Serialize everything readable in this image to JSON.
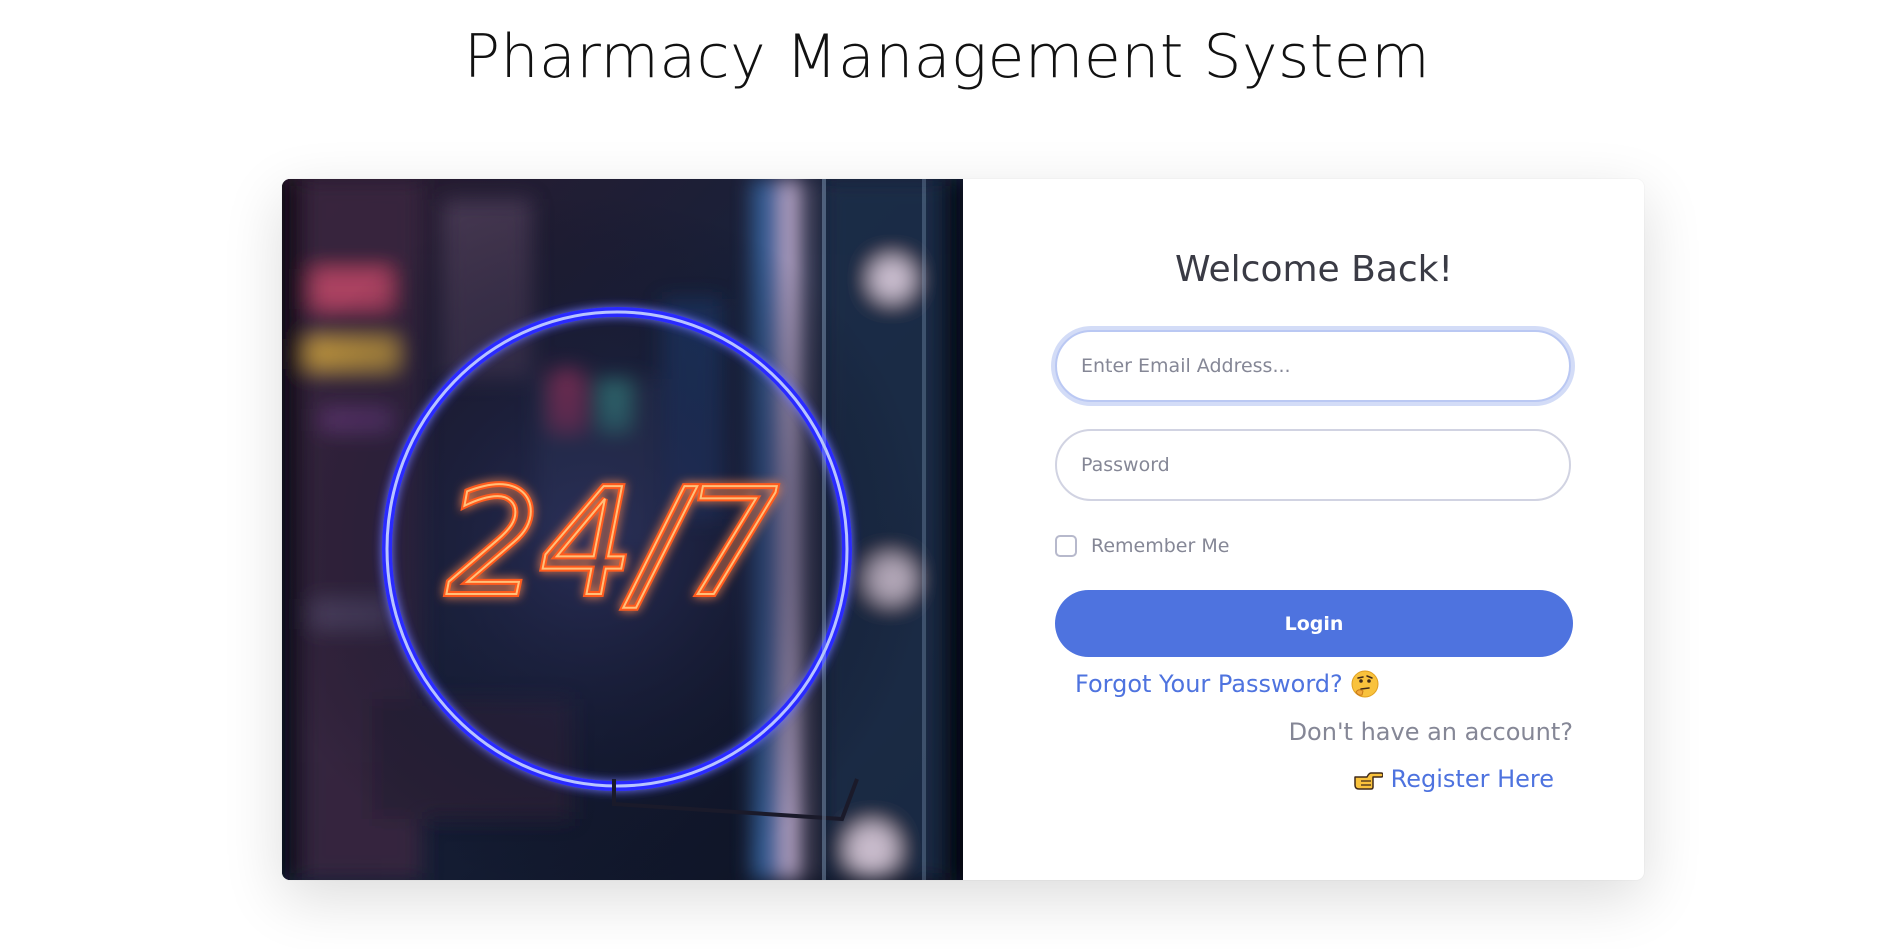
{
  "page": {
    "title": "Pharmacy Management System"
  },
  "hero_image": {
    "sign_text": "24/7"
  },
  "login_form": {
    "heading": "Welcome Back!",
    "email": {
      "value": "",
      "placeholder": "Enter Email Address..."
    },
    "password": {
      "value": "",
      "placeholder": "Password"
    },
    "remember_me": {
      "label": "Remember Me",
      "checked": false
    },
    "login_button": "Login",
    "forgot_password_link": "Forgot Your Password?",
    "no_account_text": "Don't have an account?",
    "register_link": "Register Here"
  },
  "icons": {
    "forgot": "thinking-face-icon",
    "register": "pointing-hand-icon"
  },
  "colors": {
    "primary": "#4e73df",
    "text_dark": "#3a3b45",
    "text_muted": "#858796",
    "neon_blue": "#3a3aff",
    "neon_orange": "#ff5a1e"
  }
}
